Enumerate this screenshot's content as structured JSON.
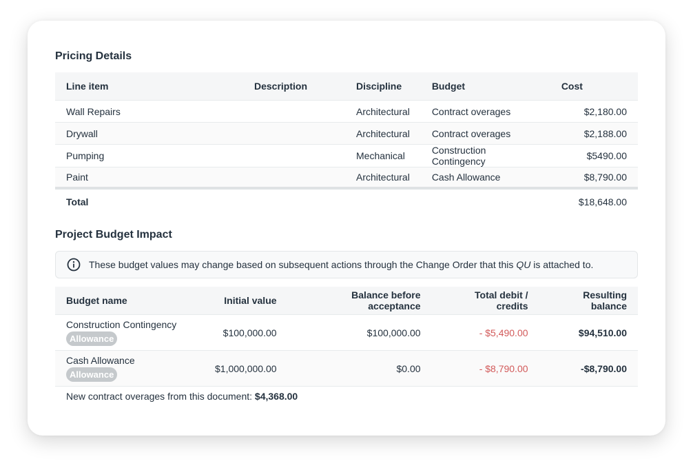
{
  "pricing": {
    "title": "Pricing Details",
    "columns": [
      "Line item",
      "Description",
      "Discipline",
      "Budget",
      "Cost"
    ],
    "rows": [
      {
        "line_item": "Wall Repairs",
        "description": "",
        "discipline": "Architectural",
        "budget": "Contract overages",
        "cost": "$2,180.00"
      },
      {
        "line_item": "Drywall",
        "description": "",
        "discipline": "Architectural",
        "budget": "Contract overages",
        "cost": "$2,188.00"
      },
      {
        "line_item": "Pumping",
        "description": "",
        "discipline": "Mechanical",
        "budget": "Construction Contingency",
        "cost": "$5490.00"
      },
      {
        "line_item": "Paint",
        "description": "",
        "discipline": "Architectural",
        "budget": "Cash Allowance",
        "cost": "$8,790.00"
      }
    ],
    "total_label": "Total",
    "total_value": "$18,648.00"
  },
  "impact": {
    "title": "Project Budget Impact",
    "info_prefix": "These budget values may change based on subsequent actions through the Change Order that this",
    "info_em": "QU",
    "info_suffix": "is attached to.",
    "columns": [
      "Budget name",
      "Initial value",
      "Balance before acceptance",
      "Total debit / credits",
      "Resulting balance"
    ],
    "rows": [
      {
        "name": "Construction Contingency",
        "badge": "Allowance",
        "initial": "$100,000.00",
        "before": "$100,000.00",
        "debit": "- $5,490.00",
        "result": "$94,510.00"
      },
      {
        "name": "Cash Allowance",
        "badge": "Allowance",
        "initial": "$1,000,000.00",
        "before": "$0.00",
        "debit": "- $8,790.00",
        "result": "-$8,790.00"
      }
    ],
    "overages_label": "New contract overages from this document:",
    "overages_value": "$4,368.00"
  },
  "colors": {
    "negative": "#d25a5a",
    "text": "#24313e",
    "badge_bg": "#c5c9cc"
  },
  "icons": {
    "info": "info-circle-icon"
  }
}
